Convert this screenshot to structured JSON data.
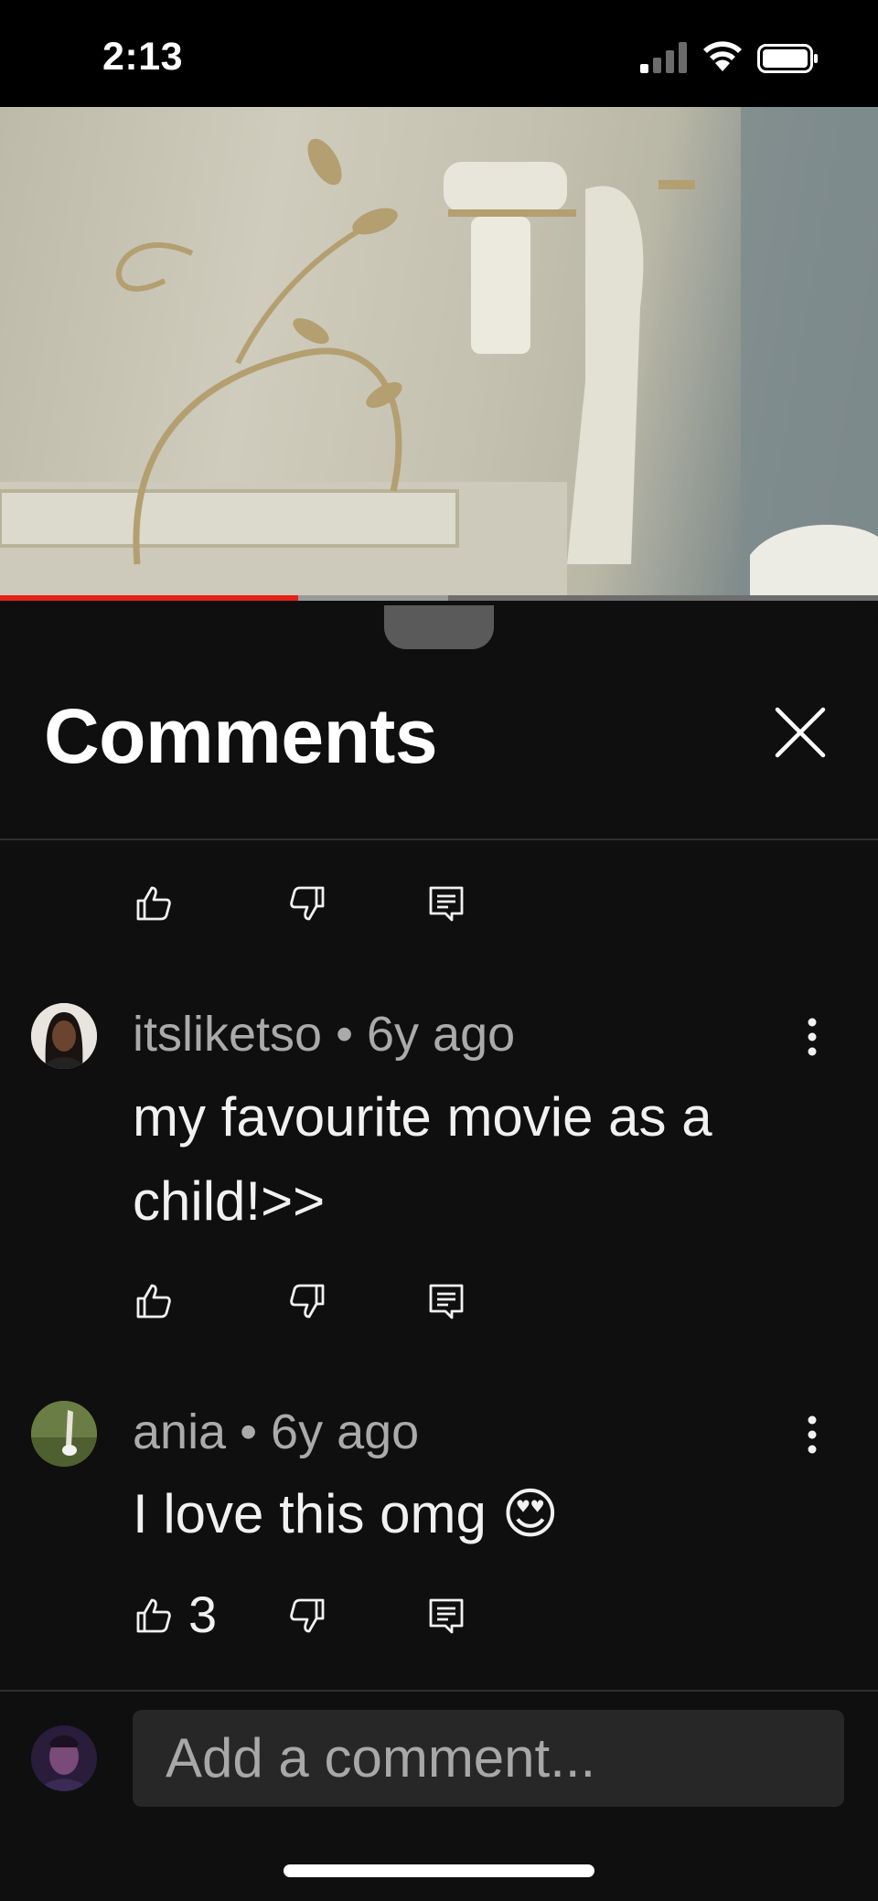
{
  "status_bar": {
    "time": "2:13"
  },
  "sheet": {
    "title": "Comments"
  },
  "comments": [
    {
      "author": "itsliketso",
      "age": "6y ago",
      "separator": "•",
      "text_lines": [
        "my favourite movie as a",
        "child!>>"
      ],
      "likes": ""
    },
    {
      "author": "ania",
      "age": "6y ago",
      "separator": "•",
      "text_lines": [
        "I love this omg 😍"
      ],
      "likes": "3"
    }
  ],
  "composer": {
    "placeholder": "Add a comment..."
  },
  "video": {
    "progress_fraction": 0.34,
    "buffered_fraction": 0.51
  },
  "colors": {
    "accent": "#e62117",
    "background": "#0f0f0f",
    "input": "#272727",
    "meta_text": "#aaaaaa"
  },
  "icons": [
    "signal-icon",
    "wifi-icon",
    "battery-icon",
    "close-icon",
    "thumbs-up-icon",
    "thumbs-down-icon",
    "reply-icon",
    "more-vert-icon"
  ]
}
